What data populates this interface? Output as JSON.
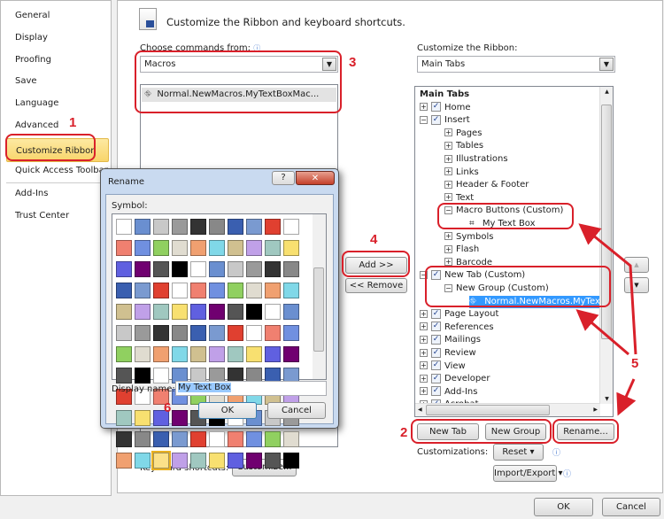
{
  "sidebar": {
    "items": [
      {
        "label": "General"
      },
      {
        "label": "Display"
      },
      {
        "label": "Proofing"
      },
      {
        "label": "Save"
      },
      {
        "label": "Language"
      },
      {
        "label": "Advanced"
      },
      {
        "label": "Customize Ribbon",
        "selected": true
      },
      {
        "label": "Quick Access Toolbar"
      },
      {
        "label": "Add-Ins"
      },
      {
        "label": "Trust Center"
      }
    ]
  },
  "header": {
    "title": "Customize the Ribbon and keyboard shortcuts."
  },
  "left": {
    "label": "Choose commands from:",
    "selected": "Macros",
    "items": [
      "Normal.NewMacros.MyTextBoxMac..."
    ]
  },
  "right": {
    "label": "Customize the Ribbon:",
    "selected": "Main Tabs",
    "tree": [
      {
        "label": "Main Tabs",
        "level": 0,
        "header": true
      },
      {
        "label": "Home",
        "level": 0,
        "pm": "+",
        "check": true
      },
      {
        "label": "Insert",
        "level": 0,
        "pm": "-",
        "check": true
      },
      {
        "label": "Pages",
        "level": 1,
        "pm": "+"
      },
      {
        "label": "Tables",
        "level": 1,
        "pm": "+"
      },
      {
        "label": "Illustrations",
        "level": 1,
        "pm": "+"
      },
      {
        "label": "Links",
        "level": 1,
        "pm": "+"
      },
      {
        "label": "Header & Footer",
        "level": 1,
        "pm": "+"
      },
      {
        "label": "Text",
        "level": 1,
        "pm": "+"
      },
      {
        "label": "Macro Buttons (Custom)",
        "level": 1,
        "pm": "-"
      },
      {
        "label": "My Text Box",
        "level": 2,
        "icon": "textbox-icon"
      },
      {
        "label": "Symbols",
        "level": 1,
        "pm": "+"
      },
      {
        "label": "Flash",
        "level": 1,
        "pm": "+"
      },
      {
        "label": "Barcode",
        "level": 1,
        "pm": "+"
      },
      {
        "label": "New Tab (Custom)",
        "level": 0,
        "pm": "-",
        "check": true
      },
      {
        "label": "New Group (Custom)",
        "level": 1,
        "pm": "-"
      },
      {
        "label": "Normal.NewMacros.MyTextBoxMacro",
        "level": 2,
        "icon": "macro-icon",
        "selected": true
      },
      {
        "label": "Page Layout",
        "level": 0,
        "pm": "+",
        "check": true
      },
      {
        "label": "References",
        "level": 0,
        "pm": "+",
        "check": true
      },
      {
        "label": "Mailings",
        "level": 0,
        "pm": "+",
        "check": true
      },
      {
        "label": "Review",
        "level": 0,
        "pm": "+",
        "check": true
      },
      {
        "label": "View",
        "level": 0,
        "pm": "+",
        "check": true
      },
      {
        "label": "Developer",
        "level": 0,
        "pm": "+",
        "check": true
      },
      {
        "label": "Add-Ins",
        "level": 0,
        "pm": "+",
        "check": true
      },
      {
        "label": "Acrobat",
        "level": 0,
        "pm": "+",
        "check": true
      }
    ]
  },
  "buttons": {
    "add": "Add >>",
    "remove": "<< Remove",
    "new_tab": "New Tab",
    "new_group": "New Group",
    "rename": "Rename...",
    "customizations": "Customizations:",
    "reset": "Reset ▾",
    "import_export": "Import/Export ▾",
    "keyboard": "Keyboard shortcuts:",
    "customize": "Customize...",
    "ok": "OK",
    "cancel": "Cancel"
  },
  "rename_dialog": {
    "title": "Rename",
    "symbol_label": "Symbol:",
    "display_name_label": "Display name:",
    "display_name_value": "My Text Box",
    "ok": "OK",
    "cancel": "Cancel",
    "help": "?",
    "close": "✕"
  },
  "annotations": [
    "1",
    "2",
    "3",
    "4",
    "5",
    "6"
  ],
  "colors": {
    "accent_red": "#d9202a",
    "selection": "#3399ff",
    "sidebar_selected": "#fbe18a"
  }
}
